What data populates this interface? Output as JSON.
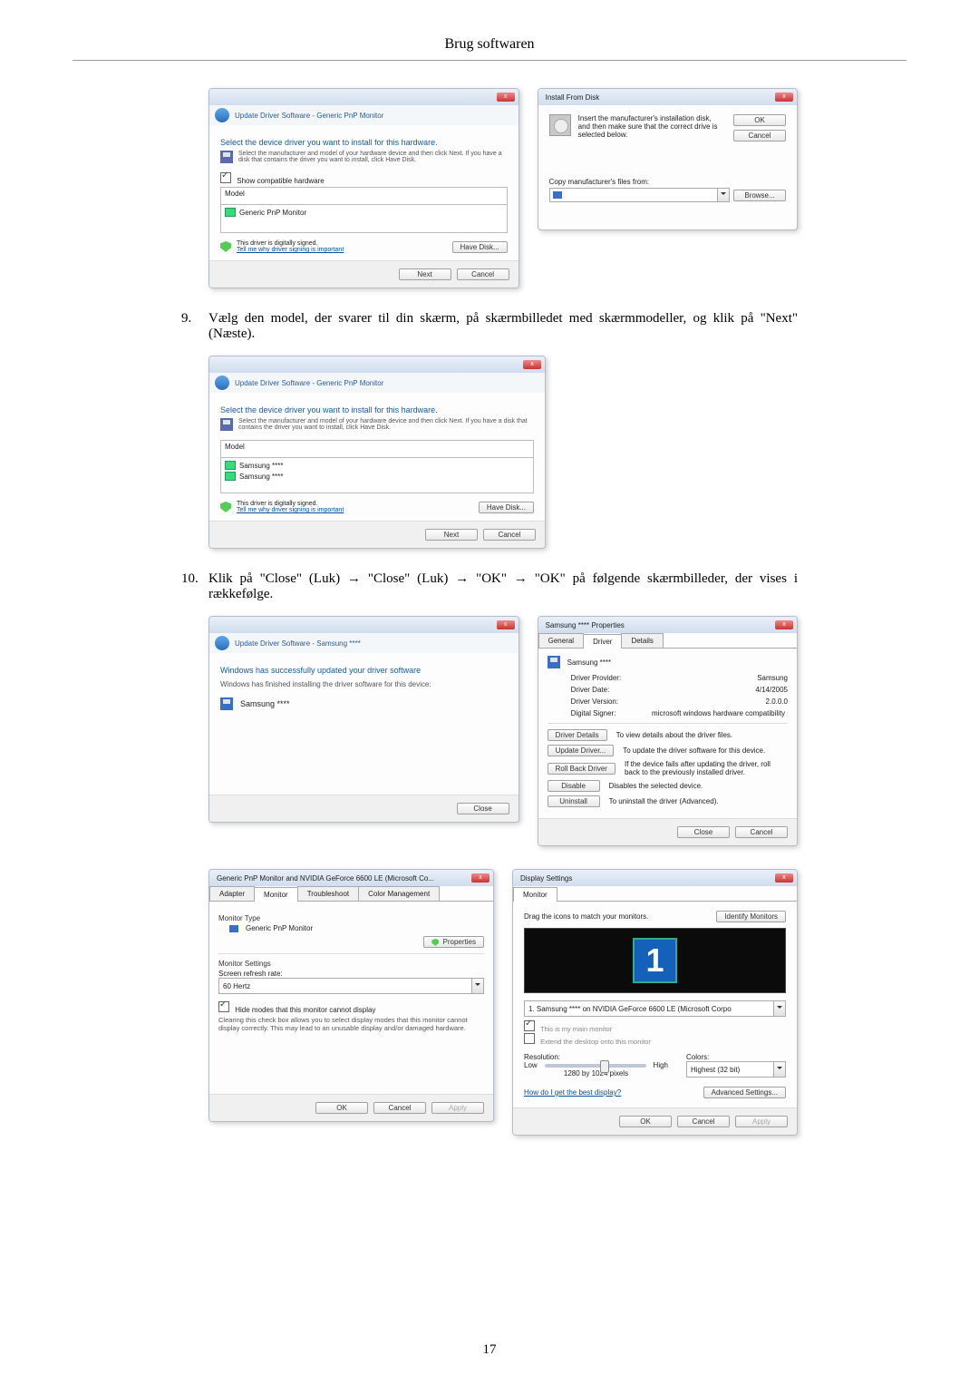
{
  "page_title": "Brug softwaren",
  "page_number": "17",
  "step9": {
    "num": "9.",
    "text": "Vælg den model, der svarer til din skærm, på skærmbilledet med skærmmodeller, og klik på \"Next\" (Næste)."
  },
  "step10": {
    "num": "10.",
    "text": "Klik på \"Close\" (Luk) → \"Close\" (Luk) → \"OK\" → \"OK\" på følgende skærmbilleder, der vises i rækkefølge."
  },
  "driver1": {
    "breadcrumb": "Update Driver Software - Generic PnP Monitor",
    "heading": "Select the device driver you want to install for this hardware.",
    "sub": "Select the manufacturer and model of your hardware device and then click Next. If you have a disk that contains the driver you want to install, click Have Disk.",
    "checkbox_label": "Show compatible hardware",
    "model_header": "Model",
    "model_item": "Generic PnP Monitor",
    "signed": "This driver is digitally signed.",
    "signed_link": "Tell me why driver signing is important",
    "have_disk": "Have Disk...",
    "next": "Next",
    "cancel": "Cancel"
  },
  "ifd": {
    "title": "Install From Disk",
    "text": "Insert the manufacturer's installation disk, and then make sure that the correct drive is selected below.",
    "ok": "OK",
    "cancel": "Cancel",
    "copy_label": "Copy manufacturer's files from:",
    "browse": "Browse..."
  },
  "driver2": {
    "breadcrumb": "Update Driver Software - Generic PnP Monitor",
    "heading": "Select the device driver you want to install for this hardware.",
    "sub": "Select the manufacturer and model of your hardware device and then click Next. If you have a disk that contains the driver you want to install, click Have Disk.",
    "model_header": "Model",
    "model_item1": "Samsung ****",
    "model_item2": "Samsung ****",
    "signed": "This driver is digitally signed.",
    "signed_link": "Tell me why driver signing is important",
    "have_disk": "Have Disk...",
    "next": "Next",
    "cancel": "Cancel"
  },
  "driver3": {
    "breadcrumb": "Update Driver Software - Samsung ****",
    "heading": "Windows has successfully updated your driver software",
    "sub": "Windows has finished installing the driver software for this device:",
    "device": "Samsung ****",
    "close": "Close"
  },
  "props": {
    "title": "Samsung **** Properties",
    "tabs": {
      "general": "General",
      "driver": "Driver",
      "details": "Details"
    },
    "device": "Samsung ****",
    "rows": {
      "provider_l": "Driver Provider:",
      "provider_v": "Samsung",
      "date_l": "Driver Date:",
      "date_v": "4/14/2005",
      "ver_l": "Driver Version:",
      "ver_v": "2.0.0.0",
      "signer_l": "Digital Signer:",
      "signer_v": "microsoft windows hardware compatibility publis"
    },
    "btns": {
      "details": "Driver Details",
      "details_d": "To view details about the driver files.",
      "update": "Update Driver...",
      "update_d": "To update the driver software for this device.",
      "rollback": "Roll Back Driver",
      "rollback_d": "If the device fails after updating the driver, roll back to the previously installed driver.",
      "disable": "Disable",
      "disable_d": "Disables the selected device.",
      "uninstall": "Uninstall",
      "uninstall_d": "To uninstall the driver (Advanced)."
    },
    "close": "Close",
    "cancel": "Cancel"
  },
  "monset": {
    "title": "Generic PnP Monitor and NVIDIA GeForce 6600 LE (Microsoft Co...",
    "tabs": {
      "adapter": "Adapter",
      "monitor": "Monitor",
      "troubleshoot": "Troubleshoot",
      "color": "Color Management"
    },
    "type_label": "Monitor Type",
    "type_value": "Generic PnP Monitor",
    "properties": "Properties",
    "settings_label": "Monitor Settings",
    "refresh_label": "Screen refresh rate:",
    "refresh_value": "60 Hertz",
    "hide_check": "Hide modes that this monitor cannot display",
    "hide_para": "Clearing this check box allows you to select display modes that this monitor cannot display correctly. This may lead to an unusable display and/or damaged hardware.",
    "ok": "OK",
    "cancel": "Cancel",
    "apply": "Apply"
  },
  "disp": {
    "title": "Display Settings",
    "tab": "Monitor",
    "drag": "Drag the icons to match your monitors.",
    "identify": "Identify Monitors",
    "mon_num": "1",
    "mon_line": "1. Samsung **** on NVIDIA GeForce 6600 LE (Microsoft Corpo",
    "chk1": "This is my main monitor",
    "chk2": "Extend the desktop onto this monitor",
    "res_label": "Resolution:",
    "low": "Low",
    "high": "High",
    "res_value": "1280 by 1024 pixels",
    "colors_label": "Colors:",
    "colors_value": "Highest (32 bit)",
    "best": "How do I get the best display?",
    "adv": "Advanced Settings...",
    "ok": "OK",
    "cancel": "Cancel",
    "apply": "Apply"
  }
}
